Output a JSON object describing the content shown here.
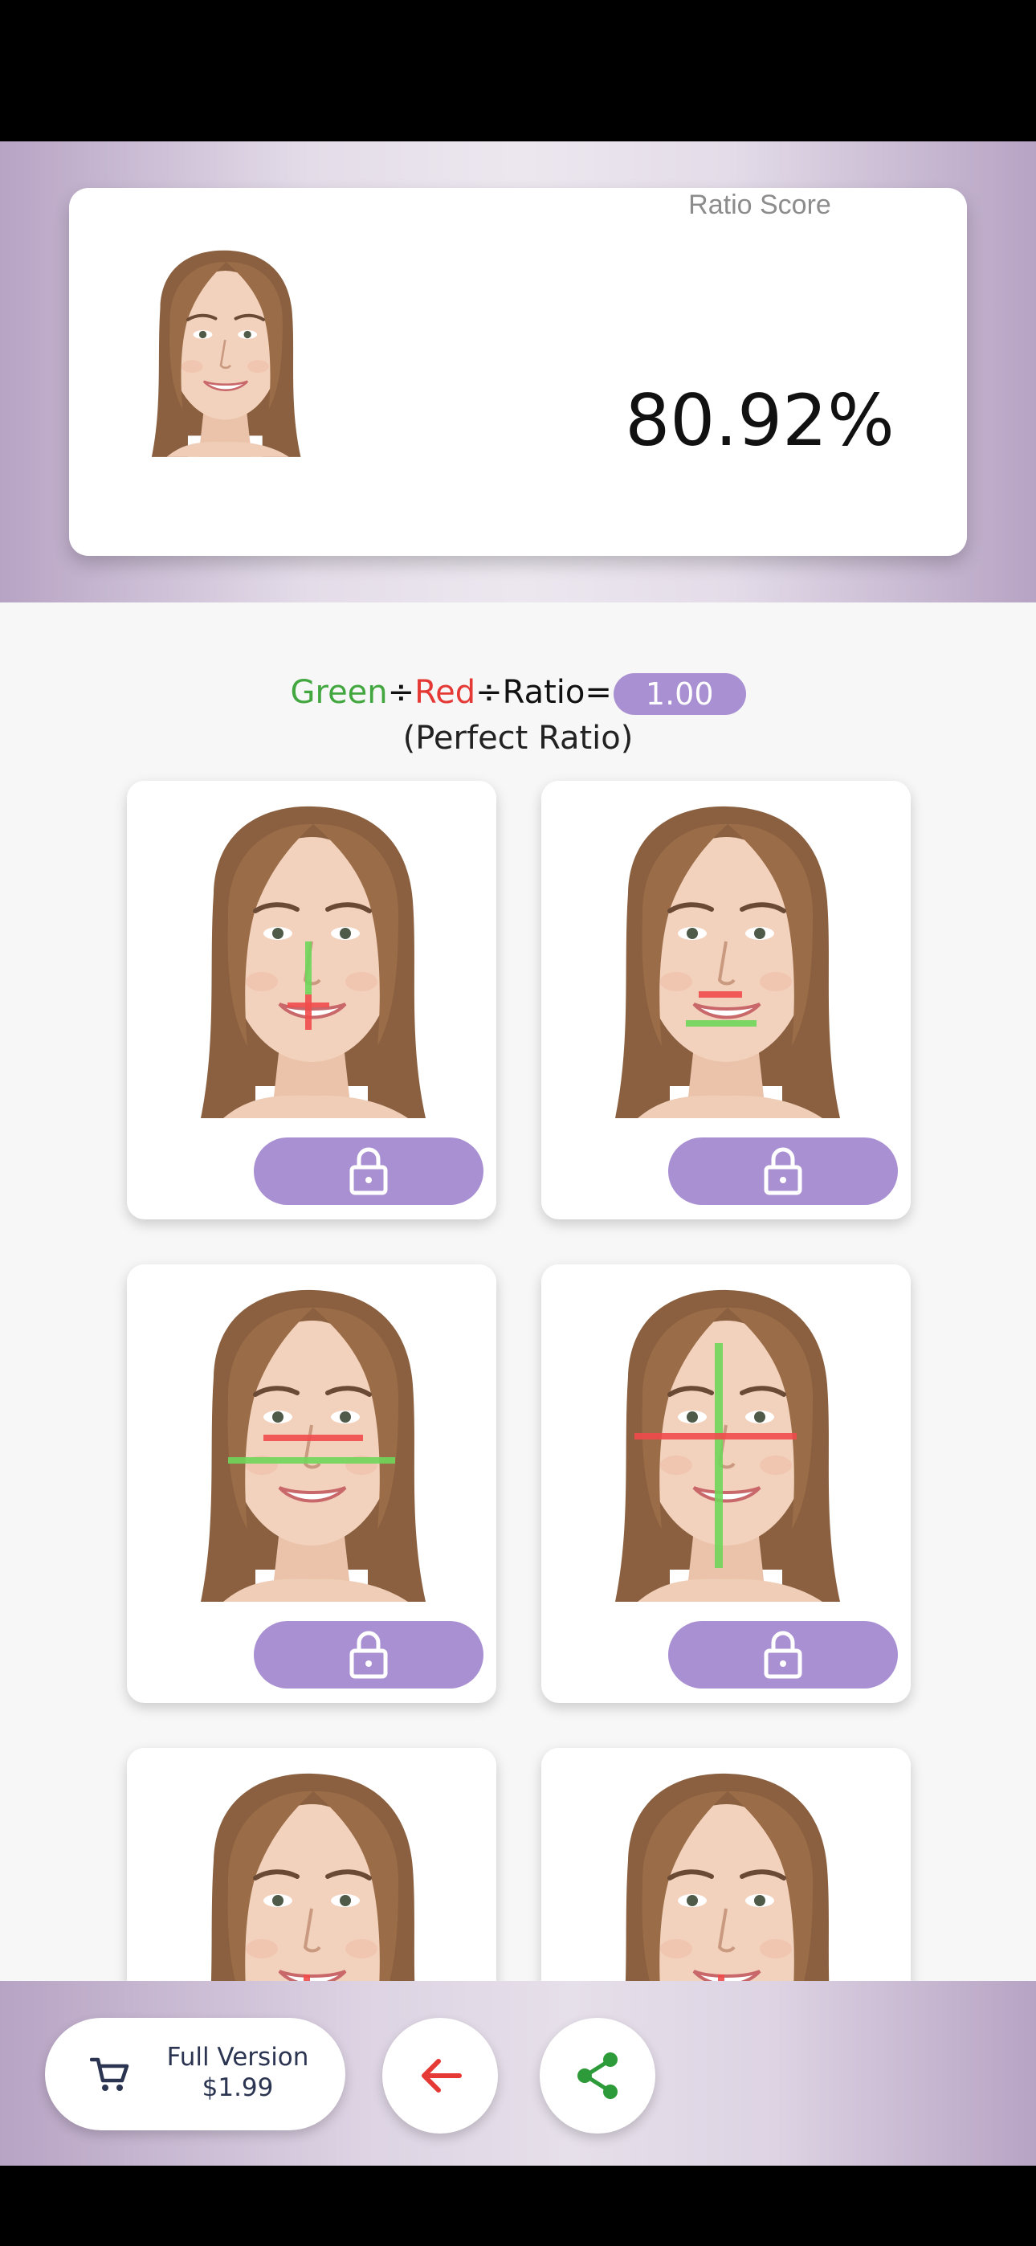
{
  "score": {
    "label": "Ratio Score",
    "value": "80.92%"
  },
  "ratio_legend": {
    "green": "Green",
    "divide1": "÷",
    "red": "Red",
    "divide2": "÷",
    "ratio": "Ratio=",
    "value": "1.00",
    "caption": "(Perfect Ratio)"
  },
  "cards": [
    {
      "overlay": "eye-line-to-nose-to-mouth",
      "locked": true
    },
    {
      "overlay": "nose-width-to-mouth-width",
      "locked": true
    },
    {
      "overlay": "eye-span-to-face-width",
      "locked": true
    },
    {
      "overlay": "face-width-to-face-length",
      "locked": true
    },
    {
      "overlay": "partial",
      "locked": true
    },
    {
      "overlay": "partial",
      "locked": true
    }
  ],
  "bottom_bar": {
    "buy_line1": "Full Version",
    "buy_line2": "$1.99",
    "back_icon": "arrow-left-icon",
    "share_icon": "share-icon"
  },
  "colors": {
    "accent": "#a990d2",
    "green": "#43a740",
    "red": "#e53935",
    "back_arrow": "#e53935",
    "share": "#2e9b3a"
  }
}
